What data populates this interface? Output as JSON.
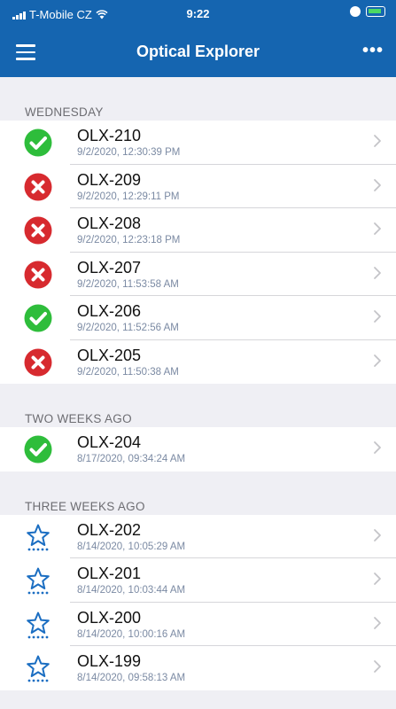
{
  "status_bar": {
    "carrier": "T-Mobile CZ",
    "time": "9:22"
  },
  "nav": {
    "title": "Optical Explorer",
    "more_label": "•••",
    "menu_icon": "hamburger-icon"
  },
  "colors": {
    "nav": "#1565b0",
    "success": "#2ebd3b",
    "error": "#d72a2f",
    "star": "#1b6ec2"
  },
  "sections": [
    {
      "header": "WEDNESDAY",
      "items": [
        {
          "name": "OLX-210",
          "date": "9/2/2020, 12:30:39 PM",
          "status": "success"
        },
        {
          "name": "OLX-209",
          "date": "9/2/2020, 12:29:11 PM",
          "status": "error"
        },
        {
          "name": "OLX-208",
          "date": "9/2/2020, 12:23:18 PM",
          "status": "error"
        },
        {
          "name": "OLX-207",
          "date": "9/2/2020, 11:53:58 AM",
          "status": "error"
        },
        {
          "name": "OLX-206",
          "date": "9/2/2020, 11:52:56 AM",
          "status": "success"
        },
        {
          "name": "OLX-205",
          "date": "9/2/2020, 11:50:38 AM",
          "status": "error"
        }
      ]
    },
    {
      "header": "TWO WEEKS AGO",
      "items": [
        {
          "name": "OLX-204",
          "date": "8/17/2020, 09:34:24 AM",
          "status": "success"
        }
      ]
    },
    {
      "header": "THREE WEEKS AGO",
      "items": [
        {
          "name": "OLX-202",
          "date": "8/14/2020, 10:05:29 AM",
          "status": "pending"
        },
        {
          "name": "OLX-201",
          "date": "8/14/2020, 10:03:44 AM",
          "status": "pending"
        },
        {
          "name": "OLX-200",
          "date": "8/14/2020, 10:00:16 AM",
          "status": "pending"
        },
        {
          "name": "OLX-199",
          "date": "8/14/2020, 09:58:13 AM",
          "status": "pending"
        }
      ]
    }
  ]
}
